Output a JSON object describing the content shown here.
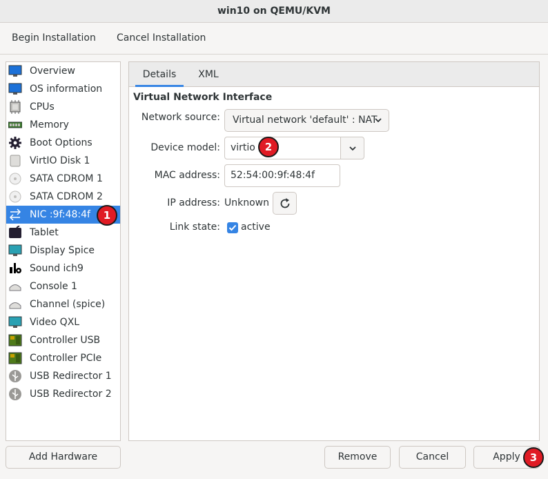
{
  "window": {
    "title": "win10 on QEMU/KVM"
  },
  "menu": {
    "begin": "Begin Installation",
    "cancel": "Cancel Installation"
  },
  "sidebar": {
    "items": [
      {
        "label": "Overview",
        "icon": "monitor-icon"
      },
      {
        "label": "OS information",
        "icon": "monitor-icon"
      },
      {
        "label": "CPUs",
        "icon": "cpu-icon"
      },
      {
        "label": "Memory",
        "icon": "memory-icon"
      },
      {
        "label": "Boot Options",
        "icon": "gear-icon"
      },
      {
        "label": "VirtIO Disk 1",
        "icon": "disk-icon"
      },
      {
        "label": "SATA CDROM 1",
        "icon": "cdrom-icon"
      },
      {
        "label": "SATA CDROM 2",
        "icon": "cdrom-icon"
      },
      {
        "label": "NIC :9f:48:4f",
        "icon": "network-icon",
        "selected": true
      },
      {
        "label": "Tablet",
        "icon": "tablet-icon"
      },
      {
        "label": "Display Spice",
        "icon": "display-icon"
      },
      {
        "label": "Sound ich9",
        "icon": "sound-icon"
      },
      {
        "label": "Console 1",
        "icon": "console-icon"
      },
      {
        "label": "Channel (spice)",
        "icon": "channel-icon"
      },
      {
        "label": "Video QXL",
        "icon": "video-icon"
      },
      {
        "label": "Controller USB",
        "icon": "controller-icon"
      },
      {
        "label": "Controller PCIe",
        "icon": "controller-icon"
      },
      {
        "label": "USB Redirector 1",
        "icon": "usb-icon"
      },
      {
        "label": "USB Redirector 2",
        "icon": "usb-icon"
      }
    ]
  },
  "tabs": {
    "details": "Details",
    "xml": "XML"
  },
  "details": {
    "section_title": "Virtual Network Interface",
    "network_source_label": "Network source:",
    "network_source_value": "Virtual network 'default' : NAT",
    "device_model_label": "Device model:",
    "device_model_value": "virtio",
    "mac_label": "MAC address:",
    "mac_value": "52:54:00:9f:48:4f",
    "ip_label": "IP address:",
    "ip_value": "Unknown",
    "link_label": "Link state:",
    "link_value": "active"
  },
  "buttons": {
    "add_hardware": "Add Hardware",
    "remove": "Remove",
    "cancel": "Cancel",
    "apply": "Apply"
  },
  "badges": {
    "one": "1",
    "two": "2",
    "three": "3"
  },
  "colors": {
    "accent": "#3584e4",
    "badge": "#e01b24"
  }
}
